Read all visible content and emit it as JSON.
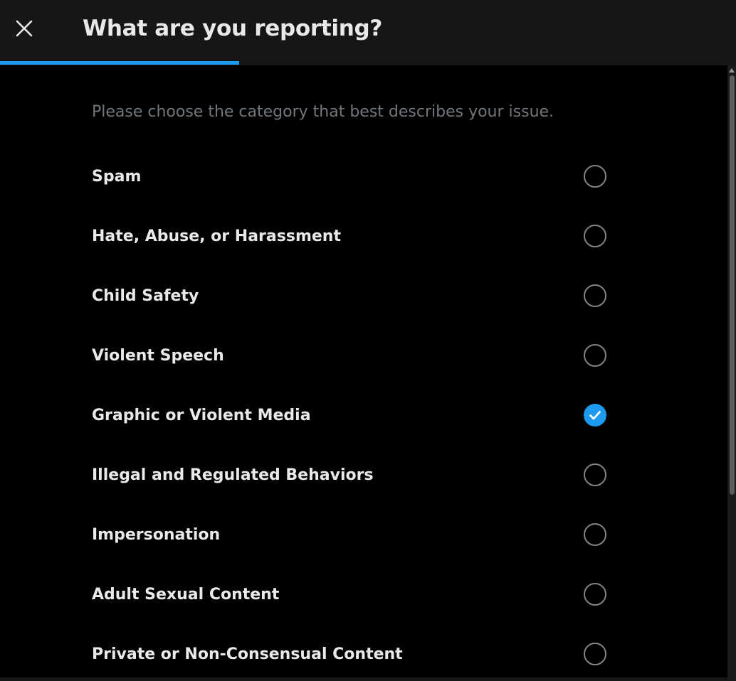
{
  "header": {
    "close_icon": "close-icon",
    "title": "What are you reporting?"
  },
  "progress": {
    "fraction": 0.325,
    "color": "#1d9bf0"
  },
  "subtitle": "Please choose the category that best describes your issue.",
  "options": [
    {
      "label": "Spam",
      "selected": false
    },
    {
      "label": "Hate, Abuse, or Harassment",
      "selected": false
    },
    {
      "label": "Child Safety",
      "selected": false
    },
    {
      "label": "Violent Speech",
      "selected": false
    },
    {
      "label": "Graphic or Violent Media",
      "selected": true
    },
    {
      "label": "Illegal and Regulated Behaviors",
      "selected": false
    },
    {
      "label": "Impersonation",
      "selected": false
    },
    {
      "label": "Adult Sexual Content",
      "selected": false
    },
    {
      "label": "Private or Non-Consensual Content",
      "selected": false
    }
  ],
  "colors": {
    "accent": "#1d9bf0",
    "text_primary": "#e7e9ea",
    "text_secondary": "#71767b",
    "background": "#000000",
    "header_background": "#161616"
  }
}
